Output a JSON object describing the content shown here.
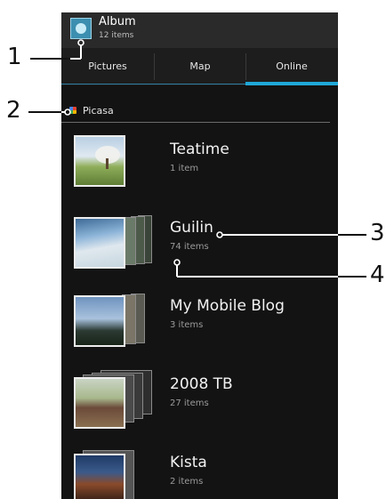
{
  "header": {
    "title": "Album",
    "count": "12 items"
  },
  "tabs": [
    {
      "label": "Pictures",
      "active": false
    },
    {
      "label": "Map",
      "active": false
    },
    {
      "label": "Online",
      "active": true
    }
  ],
  "account": {
    "label": "Picasa",
    "icon": "picasa-icon"
  },
  "albums": [
    {
      "title": "Teatime",
      "count": "1 item"
    },
    {
      "title": "Guilin",
      "count": "74 items"
    },
    {
      "title": "My Mobile Blog",
      "count": "3 items"
    },
    {
      "title": "2008 TB",
      "count": "27 items"
    },
    {
      "title": "Kista",
      "count": "2 items"
    }
  ],
  "callouts": [
    "1",
    "2",
    "3",
    "4"
  ],
  "colors": {
    "accent": "#1fa8d8",
    "background": "#131313"
  }
}
